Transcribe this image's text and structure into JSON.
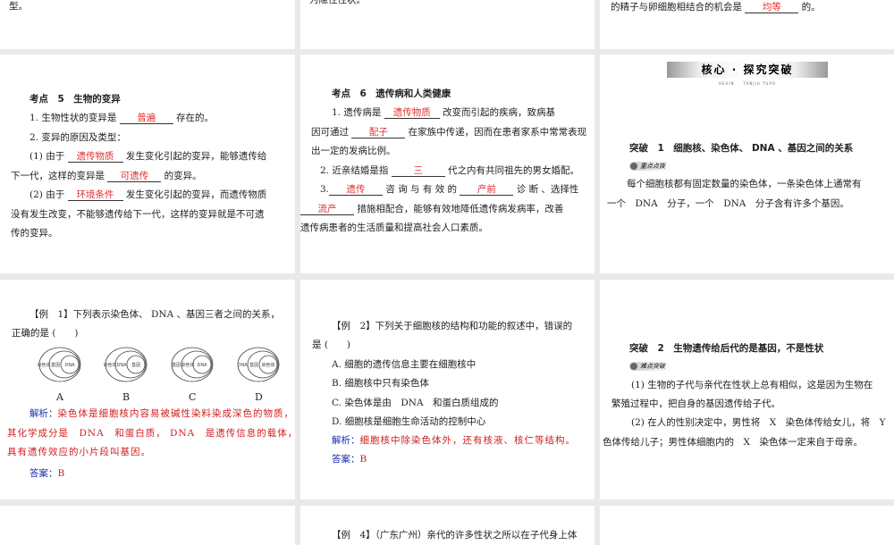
{
  "slides": [
    {
      "lines": [
        [
          {
            "t": "型。"
          }
        ]
      ]
    },
    {
      "lines": [
        [
          {
            "t": "为隐性性状。"
          }
        ]
      ]
    },
    {
      "lines": [
        [
          {
            "t": "的精子与卵细胞相结合的机会是 "
          },
          {
            "a": "均等"
          },
          {
            "t": " 的。"
          }
        ]
      ]
    },
    {
      "lines": [
        [
          {
            "b": "考点　5　生物的变异"
          }
        ],
        [
          {
            "t": "1. 生物性状的变异是 "
          },
          {
            "a": "普遍"
          },
          {
            "t": " 存在的。"
          }
        ],
        [
          {
            "t": "2. 变异的原因及类型："
          }
        ],
        [
          {
            "t": "(1) 由于 "
          },
          {
            "a": "遗传物质"
          },
          {
            "t": " 发生变化引起的变异，能够遗传给"
          }
        ],
        [
          {
            "t": "下一代，这样的变异是 "
          },
          {
            "a": "可遗传"
          },
          {
            "t": " 的变异。"
          }
        ],
        [
          {
            "t": "(2) 由于 "
          },
          {
            "a": "环境条件"
          },
          {
            "t": " 发生变化引起的变异，而遗传物质"
          }
        ],
        [
          {
            "t": "没有发生改变，不能够遗传给下一代，这样的变异就是不可遗"
          }
        ],
        [
          {
            "t": "传的变异。"
          }
        ]
      ]
    },
    {
      "lines": [
        [
          {
            "b": "考点　6　遗传病和人类健康"
          }
        ],
        [
          {
            "t": "1. 遗传病是 "
          },
          {
            "a": "遗传物质"
          },
          {
            "t": " 改变而引起的疾病，致病基"
          }
        ],
        [
          {
            "t": "因可通过 "
          },
          {
            "a": "配子"
          },
          {
            "t": " 在家族中传递，因而在患者家系中常常表现"
          }
        ],
        [
          {
            "t": "出一定的发病比例。"
          }
        ],
        [
          {
            "t": "2. 近亲结婚是指 "
          },
          {
            "a": "三"
          },
          {
            "t": " 代之内有共同祖先的男女婚配。"
          }
        ],
        [
          {
            "t": "3."
          },
          {
            "a": "遗传"
          },
          {
            "t": " 咨 询 与 有 效 的 "
          },
          {
            "a": "产前"
          },
          {
            "t": " 诊 断 、选择性"
          }
        ],
        [
          {
            "a": "流产"
          },
          {
            "t": " 措施相配合，能够有效地降低遗传病发病率，改善"
          }
        ],
        [
          {
            "t": "遗传病患者的生活质量和提高社会人口素质。"
          }
        ]
      ]
    },
    {
      "banner": "核心 · 探究突破",
      "banner_sub": "HEXIN　　TANJIU TUPO",
      "badge": "重点点拨",
      "lines": [
        [
          {
            "b": "突破　1　细胞核、染色体、 DNA 、基因之间的关系"
          }
        ],
        [
          {
            "t": "每个细胞核都有固定数量的染色体，一条染色体上通常有"
          }
        ],
        [
          {
            "t": "一个　DNA　分子，一个　DNA　分子含有许多个基因。"
          }
        ]
      ]
    },
    {
      "options": [
        "A",
        "B",
        "C",
        "D"
      ],
      "diagrams": [
        [
          "染色体",
          "基因",
          "DNA"
        ],
        [
          "染色体",
          "DNA",
          "基因"
        ],
        [
          "基因",
          "染色体",
          "DNA"
        ],
        [
          "DNA",
          "基因",
          "染色体"
        ]
      ],
      "lines": [
        [
          {
            "t": "【例　1】下列表示染色体、 DNA 、基因三者之间的关系，"
          }
        ],
        [
          {
            "t": "正确的是 (　　)"
          }
        ],
        [
          {
            "l": "解析："
          },
          {
            "r": "染色体是细胞核内容易被碱性染料染成深色的物质，"
          }
        ],
        [
          {
            "r": "其化学成分是　DNA　和蛋白质， DNA　是遗传信息的载体，其上"
          }
        ],
        [
          {
            "r": "具有遗传效应的小片段叫基因。"
          }
        ],
        [
          {
            "l": "答案："
          },
          {
            "r": "B"
          }
        ]
      ]
    },
    {
      "lines": [
        [
          {
            "t": "【例　2】下列关于细胞核的结构和功能的叙述中，错误的"
          }
        ],
        [
          {
            "t": "是 (　　)"
          }
        ],
        [
          {
            "t": "A. 细胞的遗传信息主要在细胞核中"
          }
        ],
        [
          {
            "t": "B. 细胞核中只有染色体"
          }
        ],
        [
          {
            "t": "C. 染色体是由　DNA　和蛋白质组成的"
          }
        ],
        [
          {
            "t": "D. 细胞核是细胞生命活动的控制中心"
          }
        ],
        [
          {
            "l": "解析："
          },
          {
            "r": "细胞核中除染色体外，还有核液、核仁等结构。"
          }
        ],
        [
          {
            "l": "答案："
          },
          {
            "r": "B"
          }
        ]
      ]
    },
    {
      "badge": "难点突破",
      "lines": [
        [
          {
            "b": "突破　2　生物遗传给后代的是基因，不是性状"
          }
        ],
        [
          {
            "t": "(1) 生物的子代与亲代在性状上总有相似，这是因为生物在"
          }
        ],
        [
          {
            "t": "繁殖过程中，把自身的基因遗传给子代。"
          }
        ],
        [
          {
            "t": "(2) 在人的性别决定中，男性将　X　染色体传给女儿，将　Y　染"
          }
        ],
        [
          {
            "t": "色体传给儿子；男性体细胞内的　X　染色体一定来自于母亲。"
          }
        ]
      ]
    },
    {
      "lines": []
    },
    {
      "lines": [
        [
          {
            "t": "【例　4】（广东广州）亲代的许多性状之所以在子代身上体"
          }
        ]
      ]
    },
    {
      "lines": []
    }
  ]
}
